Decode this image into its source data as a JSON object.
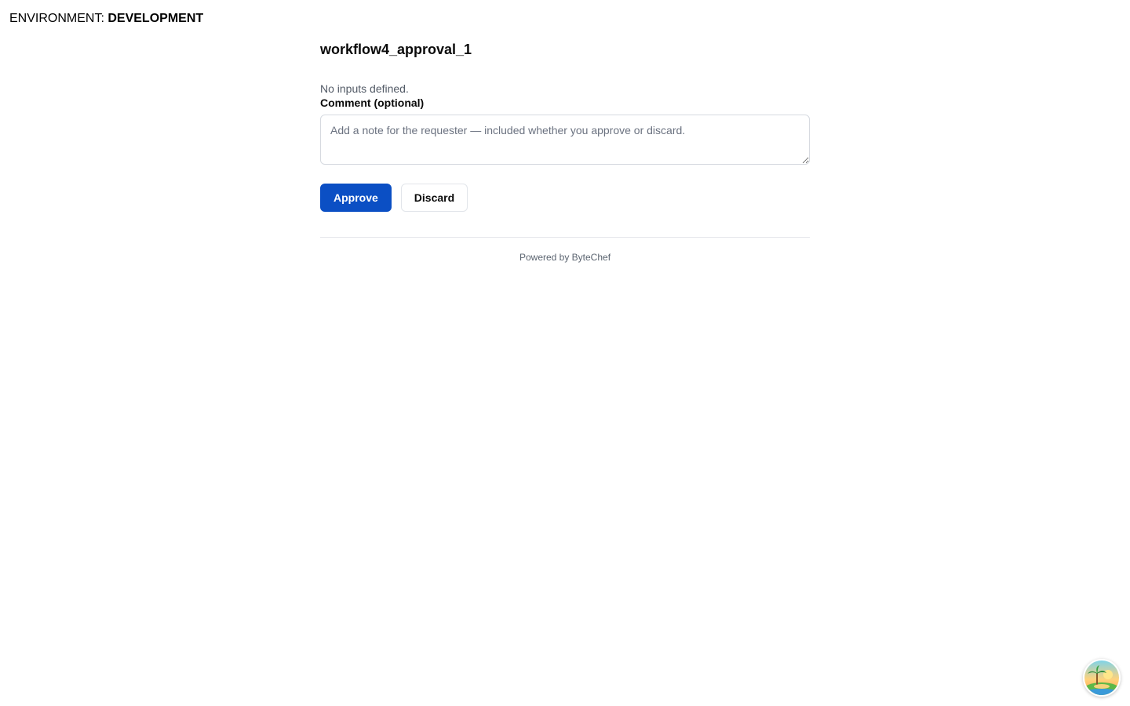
{
  "environment": {
    "label": "ENVIRONMENT:",
    "value": "DEVELOPMENT"
  },
  "form": {
    "title": "workflow4_approval_1",
    "no_inputs_text": "No inputs defined.",
    "comment_label": "Comment (optional)",
    "comment_placeholder": "Add a note for the requester — included whether you approve or discard.",
    "comment_value": "",
    "approve_label": "Approve",
    "discard_label": "Discard"
  },
  "footer": {
    "powered_by": "Powered by ByteChef"
  },
  "avatar": {
    "icon": "tropical-island-avatar-icon"
  },
  "colors": {
    "primary": "#0b4fc4",
    "border": "#d6dae0",
    "muted_text": "#525a66"
  }
}
